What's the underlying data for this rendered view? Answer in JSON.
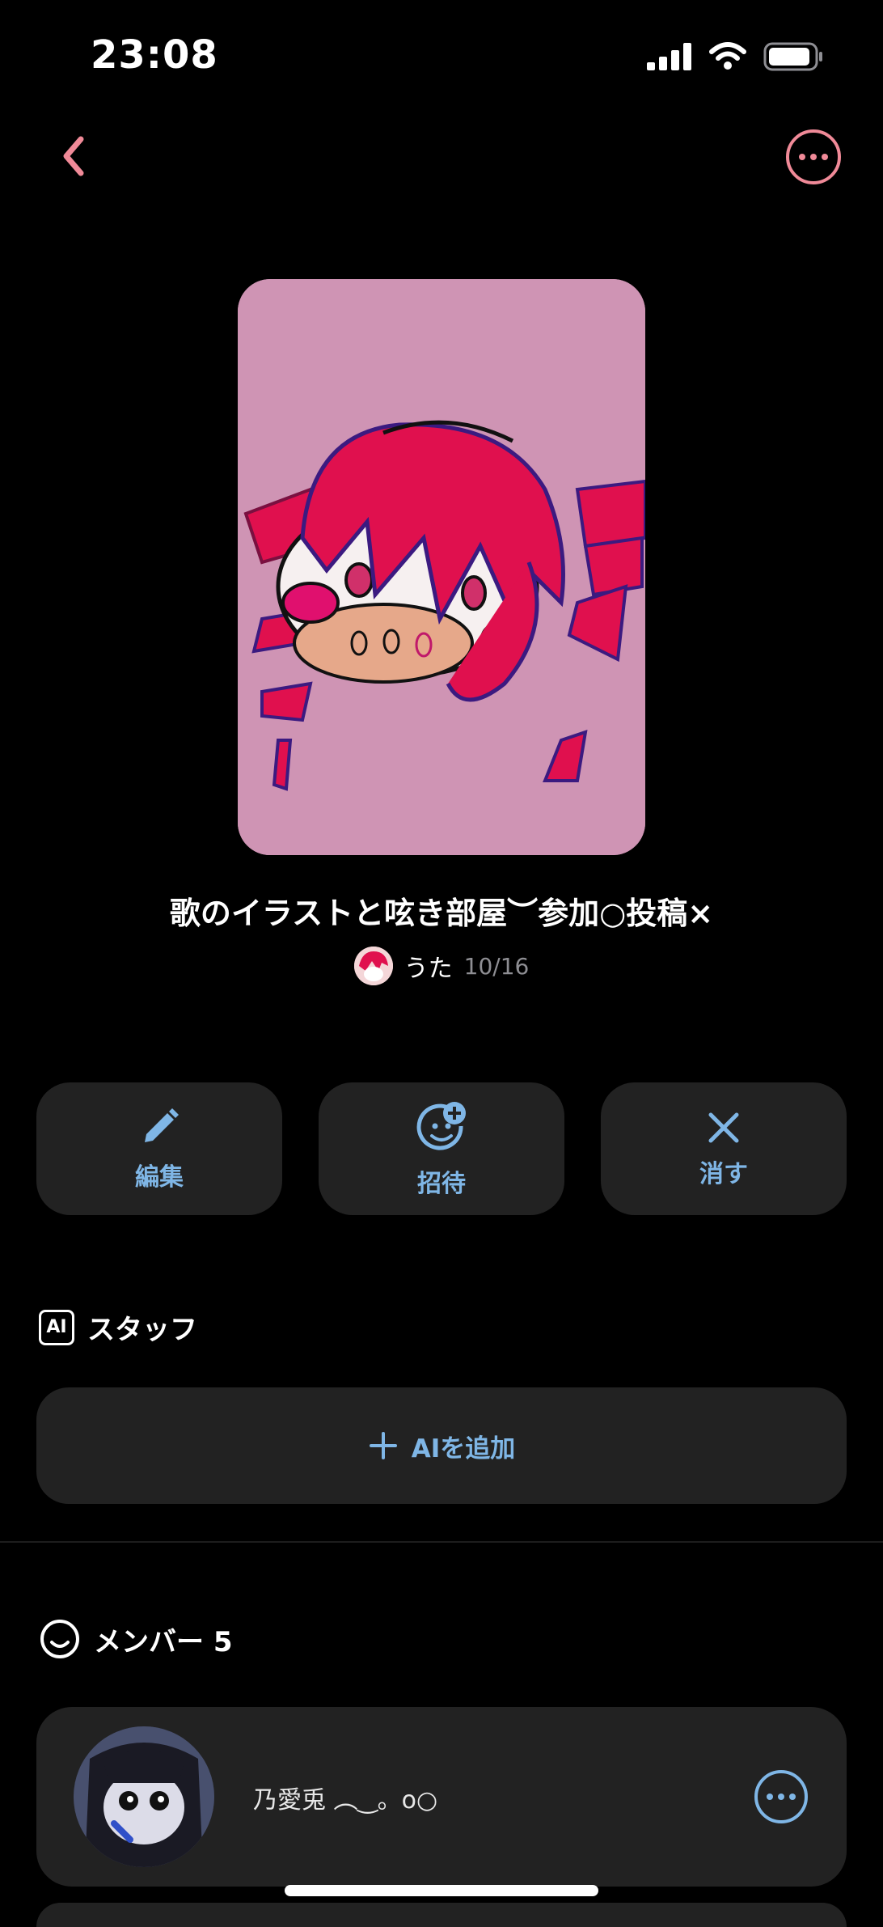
{
  "status_bar": {
    "time": "23:08",
    "battery_icon": "battery-icon",
    "wifi_icon": "wifi-icon",
    "signal_icon": "signal-icon"
  },
  "nav": {
    "back_icon": "chevron-left-icon",
    "more_icon": "more-horizontal-icon",
    "accent_color": "#f08a98"
  },
  "room": {
    "title": "歌のイラストと呟き部屋︶参加○投稿×",
    "owner_name": "うた",
    "date": "10/16"
  },
  "actions": [
    {
      "label": "編集",
      "icon": "pencil-icon"
    },
    {
      "label": "招待",
      "icon": "invite-face-plus-icon"
    },
    {
      "label": "消す",
      "icon": "close-icon"
    }
  ],
  "staff": {
    "heading": "スタッフ",
    "badge": "AI",
    "add_label": "AIを追加"
  },
  "members": {
    "heading": "メンバー 5",
    "list": [
      {
        "name": "乃愛兎 ︵‿。o○"
      }
    ]
  },
  "colors": {
    "link": "#7fb6e6",
    "card": "#222222",
    "background": "#000000"
  }
}
